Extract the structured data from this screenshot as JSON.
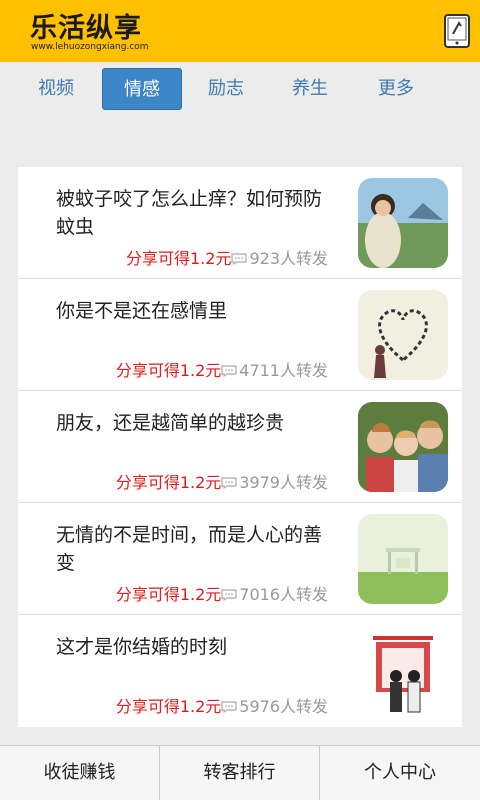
{
  "header": {
    "logo_title": "乐活纵享",
    "logo_url": "www.lehuozongxiang.com"
  },
  "tabs": [
    {
      "label": "视频",
      "active": false
    },
    {
      "label": "情感",
      "active": true
    },
    {
      "label": "励志",
      "active": false
    },
    {
      "label": "养生",
      "active": false
    },
    {
      "label": "更多",
      "active": false
    }
  ],
  "articles": [
    {
      "title": "被蚊子咬了怎么止痒？如何预防蚊虫",
      "reward": "分享可得1.2元",
      "shares": "923人转发"
    },
    {
      "title": "你是不是还在感情里",
      "reward": "分享可得1.2元",
      "shares": "4711人转发"
    },
    {
      "title": "朋友，还是越简单的越珍贵",
      "reward": "分享可得1.2元",
      "shares": "3979人转发"
    },
    {
      "title": "无情的不是时间，而是人心的善变",
      "reward": "分享可得1.2元",
      "shares": "7016人转发"
    },
    {
      "title": "这才是你结婚的时刻",
      "reward": "分享可得1.2元",
      "shares": "5976人转发"
    }
  ],
  "bottom_nav": [
    {
      "label": "收徒赚钱"
    },
    {
      "label": "转客排行"
    },
    {
      "label": "个人中心"
    }
  ],
  "colors": {
    "header_bg": "#ffc000",
    "tab_active_bg": "#3b86c6",
    "tab_text": "#3c7bb3",
    "reward_red": "#e21b1b"
  }
}
